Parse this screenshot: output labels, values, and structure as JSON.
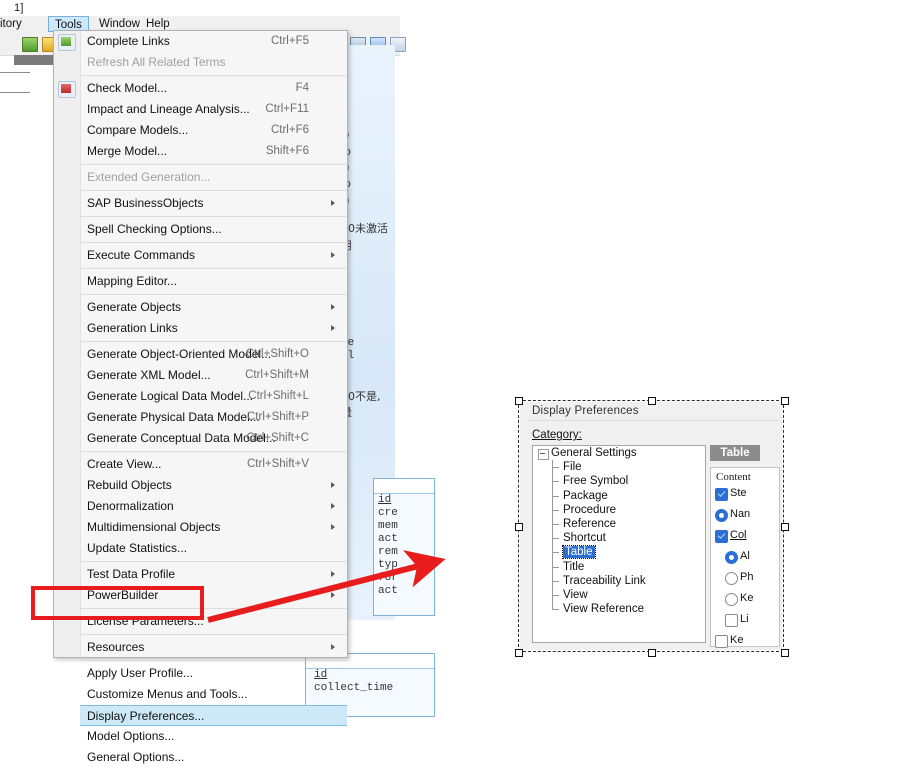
{
  "window": {
    "title_fragment": "1]"
  },
  "menubar": {
    "items": [
      {
        "label": "itory",
        "name": "menu-repository"
      },
      {
        "label": "Tools",
        "name": "menu-tools"
      },
      {
        "label": "Window",
        "name": "menu-window"
      },
      {
        "label": "Help",
        "name": "menu-help"
      }
    ]
  },
  "tools_menu": {
    "items": [
      {
        "label": "Complete Links",
        "accel": "Ctrl+F5",
        "icon": "image-icon",
        "disabled": false,
        "submenu": false,
        "separator_after": false
      },
      {
        "label": "Refresh All Related Terms",
        "accel": "",
        "disabled": true,
        "submenu": false,
        "separator_after": true
      },
      {
        "label": "Check Model...",
        "accel": "F4",
        "icon": "check-model-icon",
        "disabled": false,
        "submenu": false
      },
      {
        "label": "Impact and Lineage Analysis...",
        "accel": "Ctrl+F11",
        "disabled": false,
        "submenu": false
      },
      {
        "label": "Compare Models...",
        "accel": "Ctrl+F6",
        "disabled": false,
        "submenu": false
      },
      {
        "label": "Merge Model...",
        "accel": "Shift+F6",
        "disabled": false,
        "submenu": false,
        "separator_after": true
      },
      {
        "label": "Extended Generation...",
        "accel": "",
        "disabled": true,
        "submenu": false,
        "separator_after": true
      },
      {
        "label": "SAP BusinessObjects",
        "accel": "",
        "disabled": false,
        "submenu": true,
        "separator_after": true
      },
      {
        "label": "Spell Checking Options...",
        "accel": "",
        "disabled": false,
        "submenu": false,
        "separator_after": true
      },
      {
        "label": "Execute Commands",
        "accel": "",
        "disabled": false,
        "submenu": true,
        "separator_after": true
      },
      {
        "label": "Mapping Editor...",
        "accel": "",
        "disabled": false,
        "submenu": false,
        "separator_after": true
      },
      {
        "label": "Generate Objects",
        "accel": "",
        "disabled": false,
        "submenu": true
      },
      {
        "label": "Generation Links",
        "accel": "",
        "disabled": false,
        "submenu": true,
        "separator_after": true
      },
      {
        "label": "Generate Object-Oriented Model...",
        "accel": "Ctrl+Shift+O",
        "disabled": false,
        "submenu": false
      },
      {
        "label": "Generate XML Model...",
        "accel": "Ctrl+Shift+M",
        "disabled": false,
        "submenu": false
      },
      {
        "label": "Generate Logical Data Model...",
        "accel": "Ctrl+Shift+L",
        "disabled": false,
        "submenu": false
      },
      {
        "label": "Generate Physical Data Model...",
        "accel": "Ctrl+Shift+P",
        "disabled": false,
        "submenu": false
      },
      {
        "label": "Generate Conceptual Data Model...",
        "accel": "Ctrl+Shift+C",
        "disabled": false,
        "submenu": false,
        "separator_after": true
      },
      {
        "label": "Create View...",
        "accel": "Ctrl+Shift+V",
        "disabled": false,
        "submenu": false
      },
      {
        "label": "Rebuild Objects",
        "accel": "",
        "disabled": false,
        "submenu": true
      },
      {
        "label": "Denormalization",
        "accel": "",
        "disabled": false,
        "submenu": true
      },
      {
        "label": "Multidimensional Objects",
        "accel": "",
        "disabled": false,
        "submenu": true
      },
      {
        "label": "Update Statistics...",
        "accel": "",
        "disabled": false,
        "submenu": false,
        "separator_after": true
      },
      {
        "label": "Test Data Profile",
        "accel": "",
        "disabled": false,
        "submenu": true
      },
      {
        "label": "PowerBuilder",
        "accel": "",
        "disabled": false,
        "submenu": true,
        "separator_after": true
      },
      {
        "label": "License Parameters...",
        "accel": "",
        "disabled": false,
        "submenu": false,
        "separator_after": true
      },
      {
        "label": "Resources",
        "accel": "",
        "disabled": false,
        "submenu": true,
        "separator_after": true
      },
      {
        "label": "Apply User Profile...",
        "accel": "",
        "disabled": false,
        "submenu": false
      },
      {
        "label": "Customize Menus and Tools...",
        "accel": "",
        "disabled": false,
        "submenu": false
      },
      {
        "label": "Display Preferences...",
        "accel": "",
        "disabled": false,
        "submenu": false,
        "selected": true
      },
      {
        "label": "Model Options...",
        "accel": "",
        "disabled": false,
        "submenu": false
      },
      {
        "label": "General Options...",
        "accel": "",
        "disabled": false,
        "submenu": false
      }
    ]
  },
  "dialog": {
    "title": "Display Preferences",
    "category_label": "Category:",
    "tree": [
      {
        "label": "General Settings",
        "level": 0,
        "selected": false
      },
      {
        "label": "File",
        "level": 1,
        "selected": false
      },
      {
        "label": "Free Symbol",
        "level": 1,
        "selected": false
      },
      {
        "label": "Package",
        "level": 1,
        "selected": false
      },
      {
        "label": "Procedure",
        "level": 1,
        "selected": false
      },
      {
        "label": "Reference",
        "level": 1,
        "selected": false
      },
      {
        "label": "Shortcut",
        "level": 1,
        "selected": false
      },
      {
        "label": "Table",
        "level": 1,
        "selected": true
      },
      {
        "label": "Title",
        "level": 1,
        "selected": false
      },
      {
        "label": "Traceability Link",
        "level": 1,
        "selected": false
      },
      {
        "label": "View",
        "level": 1,
        "selected": false
      },
      {
        "label": "View Reference",
        "level": 1,
        "selected": false,
        "last": true
      }
    ],
    "tab_label": "Table",
    "group_label": "Content",
    "controls": [
      {
        "type": "checkbox",
        "label": "Ste",
        "checked": true
      },
      {
        "type": "radio",
        "label": "Nan",
        "checked": true
      },
      {
        "type": "checkbox",
        "label": "Col",
        "checked": true,
        "underline": true
      },
      {
        "type": "radio",
        "label": "Al",
        "checked": true,
        "indent": true
      },
      {
        "type": "radio",
        "label": "Ph",
        "checked": false,
        "indent": true
      },
      {
        "type": "radio",
        "label": "Ke",
        "checked": false,
        "indent": true
      },
      {
        "type": "checkbox",
        "label": "Li",
        "checked": false,
        "indent": true
      },
      {
        "type": "checkbox",
        "label": "Ke",
        "checked": false
      }
    ]
  },
  "annotations": {
    "highlight_color": "#e81c1c",
    "arrow_menu_to_dialog": "arrow-right",
    "arrow_to_table_item": "arrow-left"
  },
  "background": {
    "canvas_texts": [
      "])",
      "ip",
      "])",
      "ip",
      "])",
      "0未激活",
      "用",
      "ne",
      "il",
      "0不是,",
      "量"
    ],
    "entity_1_columns": [
      "id",
      "cre",
      "mem",
      "act",
      "rem",
      "typ",
      "for",
      "act"
    ],
    "entity_2_columns": [
      "id",
      "collect_time"
    ]
  }
}
